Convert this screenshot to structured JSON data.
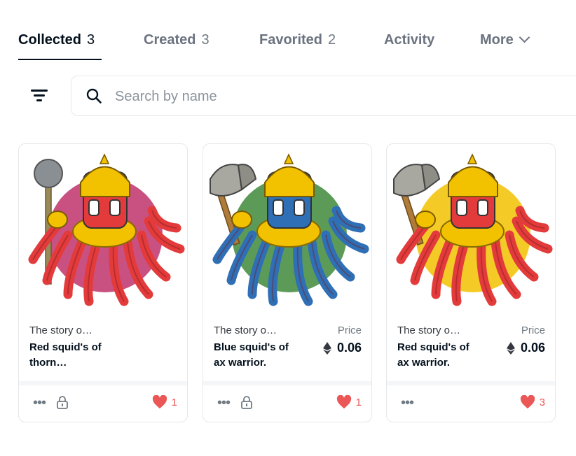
{
  "tabs": [
    {
      "label": "Collected",
      "count": "3"
    },
    {
      "label": "Created",
      "count": "3"
    },
    {
      "label": "Favorited",
      "count": "2"
    },
    {
      "label": "Activity",
      "count": ""
    },
    {
      "label": "More",
      "count": ""
    }
  ],
  "search": {
    "placeholder": "Search by name",
    "value": ""
  },
  "cards": [
    {
      "collection": "The story o…",
      "name": "Red squid's of thorn…",
      "price_label": "",
      "price": "",
      "likes": "1",
      "weapon": "mace",
      "squid_color": "#e33b3b",
      "bg_color": "#c0326b"
    },
    {
      "collection": "The story o…",
      "name": "Blue squid's of ax warrior.",
      "price_label": "Price",
      "price": "0.06",
      "likes": "1",
      "weapon": "axe",
      "squid_color": "#2f6fb5",
      "bg_color": "#3f8a3a"
    },
    {
      "collection": "The story o…",
      "name": "Red squid's of ax warrior.",
      "price_label": "Price",
      "price": "0.06",
      "likes": "3",
      "weapon": "axe",
      "squid_color": "#e33b3b",
      "bg_color": "#f2c200"
    }
  ],
  "colors": {
    "accent": "#04111d",
    "heart": "#eb5757",
    "helmet": "#f2c200"
  }
}
